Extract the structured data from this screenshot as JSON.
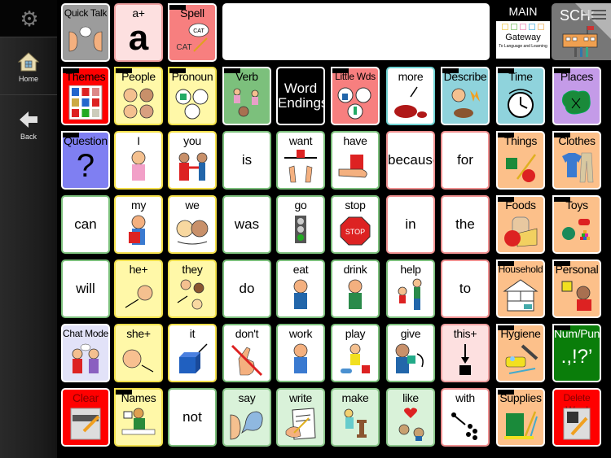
{
  "sidebar": {
    "settings_icon": "gear-icon",
    "items": [
      {
        "label": "Home",
        "icon": "home-icon"
      },
      {
        "label": "Back",
        "icon": "back-arrow-icon"
      }
    ]
  },
  "message_bar": {
    "value": ""
  },
  "top_right": {
    "main_label": "MAIN",
    "main_box_title": "Gateway",
    "main_box_subtitle": "To Language and Learning",
    "school_label": "SCHOOL",
    "menu_icon": "hamburger-menu-icon"
  },
  "colors": {
    "folder_orange": "#fcc08a",
    "folder_teal": "#8fd3dc",
    "pronoun_yellow": "#fff8a8",
    "verb_green": "#7cc07c",
    "clear_red": "#ff0000",
    "num_punc_green": "#0a7d0a"
  },
  "grid": [
    {
      "label": "Quick Talk",
      "style": "c-gray",
      "icon": "talking-faces-icon",
      "col": 0,
      "row": 0
    },
    {
      "label": "a+",
      "style": "c-lightpink",
      "icon": "letter-a-icon",
      "col": 1,
      "row": 0
    },
    {
      "label": "Spell",
      "style": "c-salmon",
      "icon": "spell-cat-icon",
      "col": 2,
      "row": 0,
      "folder": true
    },
    {
      "label": "Themes",
      "style": "c-red",
      "icon": "themes-grid-icon",
      "col": 0,
      "row": 1,
      "folder": true
    },
    {
      "label": "People",
      "style": "c-yellow",
      "icon": "people-faces-icon",
      "col": 1,
      "row": 1,
      "folder": true
    },
    {
      "label": "Pronoun",
      "style": "c-yellow",
      "icon": "pronoun-circles-icon",
      "col": 2,
      "row": 1,
      "folder": true
    },
    {
      "label": "Verb",
      "style": "c-verb",
      "icon": "verb-actions-icon",
      "col": 3,
      "row": 1,
      "folder": true
    },
    {
      "label": "Word Endings",
      "style": "c-black",
      "icon": null,
      "col": 4,
      "row": 1
    },
    {
      "label": "Little Wds",
      "style": "c-salmon",
      "icon": "little-words-icon",
      "col": 5,
      "row": 1,
      "folder": true
    },
    {
      "label": "more",
      "style": "c-white c-teal-border",
      "icon": "more-pile-icon",
      "col": 6,
      "row": 1
    },
    {
      "label": "Describe",
      "style": "c-teal",
      "icon": "describe-icon",
      "col": 7,
      "row": 1,
      "folder": true
    },
    {
      "label": "Time",
      "style": "c-teal",
      "icon": "clock-icon",
      "col": 8,
      "row": 1,
      "folder": true
    },
    {
      "label": "Places",
      "style": "c-purple",
      "icon": "map-icon",
      "col": 9,
      "row": 1,
      "folder": true
    },
    {
      "label": "Question",
      "style": "c-blue",
      "icon": "question-mark-icon",
      "col": 0,
      "row": 2,
      "folder": true
    },
    {
      "label": "I",
      "style": "c-yellowlight",
      "icon": "girl-self-icon",
      "col": 1,
      "row": 2
    },
    {
      "label": "you",
      "style": "c-yellowlight",
      "icon": "pointing-you-icon",
      "col": 2,
      "row": 2
    },
    {
      "label": "is",
      "style": "c-white c-green",
      "icon": null,
      "col": 3,
      "row": 2
    },
    {
      "label": "want",
      "style": "c-white c-green",
      "icon": "want-hands-icon",
      "col": 4,
      "row": 2
    },
    {
      "label": "have",
      "style": "c-white c-green",
      "icon": "have-hand-icon",
      "col": 5,
      "row": 2
    },
    {
      "label": "because",
      "style": "c-white c-pink",
      "icon": null,
      "col": 6,
      "row": 2
    },
    {
      "label": "for",
      "style": "c-white c-pink",
      "icon": null,
      "col": 7,
      "row": 2
    },
    {
      "label": "Things",
      "style": "c-orange",
      "icon": "things-icon",
      "col": 8,
      "row": 2,
      "folder": true
    },
    {
      "label": "Clothes",
      "style": "c-orange",
      "icon": "clothes-icon",
      "col": 9,
      "row": 2,
      "folder": true
    },
    {
      "label": "can",
      "style": "c-white c-green",
      "icon": null,
      "col": 0,
      "row": 3
    },
    {
      "label": "my",
      "style": "c-yellowlight",
      "icon": "my-person-icon",
      "col": 1,
      "row": 3
    },
    {
      "label": "we",
      "style": "c-yellowlight",
      "icon": "we-faces-icon",
      "col": 2,
      "row": 3
    },
    {
      "label": "was",
      "style": "c-white c-green",
      "icon": null,
      "col": 3,
      "row": 3
    },
    {
      "label": "go",
      "style": "c-white c-green",
      "icon": "traffic-light-icon",
      "col": 4,
      "row": 3
    },
    {
      "label": "stop",
      "style": "c-white c-green",
      "icon": "stop-sign-icon",
      "col": 5,
      "row": 3
    },
    {
      "label": "in",
      "style": "c-white c-pink",
      "icon": null,
      "col": 6,
      "row": 3
    },
    {
      "label": "the",
      "style": "c-white c-pink",
      "icon": null,
      "col": 7,
      "row": 3
    },
    {
      "label": "Foods",
      "style": "c-orange",
      "icon": "foods-icon",
      "col": 8,
      "row": 3,
      "folder": true
    },
    {
      "label": "Toys",
      "style": "c-orange",
      "icon": "toys-icon",
      "col": 9,
      "row": 3,
      "folder": true
    },
    {
      "label": "will",
      "style": "c-white c-green",
      "icon": null,
      "col": 0,
      "row": 4
    },
    {
      "label": "he+",
      "style": "c-yellow",
      "icon": "he-face-icon",
      "col": 1,
      "row": 4
    },
    {
      "label": "they",
      "style": "c-yellow",
      "icon": "they-faces-icon",
      "col": 2,
      "row": 4
    },
    {
      "label": "do",
      "style": "c-white c-green",
      "icon": null,
      "col": 3,
      "row": 4
    },
    {
      "label": "eat",
      "style": "c-white c-green",
      "icon": "eat-icon",
      "col": 4,
      "row": 4
    },
    {
      "label": "drink",
      "style": "c-white c-green",
      "icon": "drink-icon",
      "col": 5,
      "row": 4
    },
    {
      "label": "help",
      "style": "c-white c-green",
      "icon": "help-icon",
      "col": 6,
      "row": 4
    },
    {
      "label": "to",
      "style": "c-white c-pink",
      "icon": null,
      "col": 7,
      "row": 4
    },
    {
      "label": "Household",
      "style": "c-orange",
      "icon": "house-icon",
      "col": 8,
      "row": 4,
      "folder": true
    },
    {
      "label": "Personal",
      "style": "c-orange",
      "icon": "personal-icon",
      "col": 9,
      "row": 4,
      "folder": true
    },
    {
      "label": "Chat Mode",
      "style": "c-lav",
      "icon": "chat-people-icon",
      "col": 0,
      "row": 5
    },
    {
      "label": "she+",
      "style": "c-yellow",
      "icon": "she-face-icon",
      "col": 1,
      "row": 5
    },
    {
      "label": "it",
      "style": "c-yellowlight",
      "icon": "it-cube-icon",
      "col": 2,
      "row": 5
    },
    {
      "label": "don't",
      "style": "c-white c-green",
      "icon": "dont-hand-icon",
      "col": 3,
      "row": 5
    },
    {
      "label": "work",
      "style": "c-white c-green",
      "icon": "work-icon",
      "col": 4,
      "row": 5
    },
    {
      "label": "play",
      "style": "c-white c-green",
      "icon": "play-icon",
      "col": 5,
      "row": 5
    },
    {
      "label": "give",
      "style": "c-white c-green",
      "icon": "give-icon",
      "col": 6,
      "row": 5
    },
    {
      "label": "this+",
      "style": "c-lightpink",
      "icon": "this-arrow-icon",
      "col": 7,
      "row": 5
    },
    {
      "label": "Hygiene",
      "style": "c-orange",
      "icon": "hygiene-icon",
      "col": 8,
      "row": 5,
      "folder": true
    },
    {
      "label": "Num/Punc",
      "style": "c-darkgreen",
      "icon": "punctuation-icon",
      "col": 9,
      "row": 5,
      "folder": true
    },
    {
      "label": "Clear",
      "style": "c-red",
      "icon": "clear-eraser-icon",
      "col": 0,
      "row": 6
    },
    {
      "label": "Names",
      "style": "c-yellow",
      "icon": "names-icon",
      "col": 1,
      "row": 6,
      "folder": true
    },
    {
      "label": "not",
      "style": "c-white c-green",
      "icon": null,
      "col": 2,
      "row": 6
    },
    {
      "label": "say",
      "style": "c-lightgreen",
      "icon": "say-speech-icon",
      "col": 3,
      "row": 6
    },
    {
      "label": "write",
      "style": "c-lightgreen",
      "icon": "write-icon",
      "col": 4,
      "row": 6
    },
    {
      "label": "make",
      "style": "c-lightgreen",
      "icon": "make-icon",
      "col": 5,
      "row": 6
    },
    {
      "label": "like",
      "style": "c-lightgreen",
      "icon": "like-heart-icon",
      "col": 6,
      "row": 6
    },
    {
      "label": "with",
      "style": "c-white c-pink",
      "icon": "with-dots-icon",
      "col": 7,
      "row": 6
    },
    {
      "label": "Supplies",
      "style": "c-orange",
      "icon": "supplies-icon",
      "col": 8,
      "row": 6,
      "folder": true
    },
    {
      "label": "Delete Word",
      "style": "c-red",
      "icon": "delete-word-icon",
      "col": 9,
      "row": 6
    }
  ]
}
